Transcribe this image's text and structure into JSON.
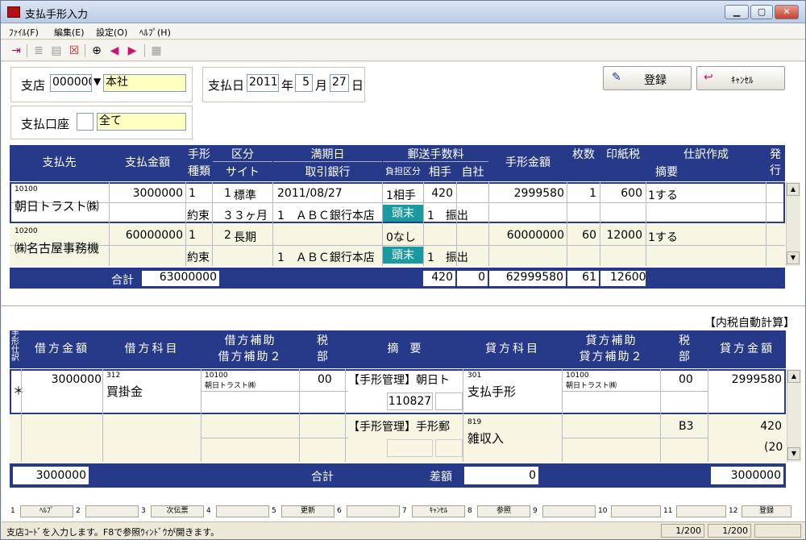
{
  "window": {
    "title": "支払手形入力",
    "min": "▁",
    "max": "▢",
    "close": "✕"
  },
  "menu": [
    "ﾌｧｲﾙ(F)",
    "編集(E)",
    "設定(O)",
    "ﾍﾙﾌﾟ(H)"
  ],
  "header": {
    "store_label": "支店",
    "store_code": "000000",
    "store_dropdown": "▼",
    "store_name": "本社",
    "date_label": "支払日",
    "year": "2011",
    "year_unit": "年",
    "month": "5",
    "month_unit": "月",
    "day": "27",
    "day_unit": "日",
    "account_label": "支払口座",
    "account_name": "全て",
    "register": "登録",
    "cancel": "ｷｬﾝｾﾙ"
  },
  "top_headers": {
    "payee": "支払先",
    "pay_amount": "支払金額",
    "note_type1": "手形",
    "note_type2": "種類",
    "category": "区分",
    "site": "サイト",
    "maturity": "満期日",
    "bank": "取引銀行",
    "mail_fee": "郵送手数料",
    "burden": "負担区分",
    "partner": "相手",
    "own": "自社",
    "note_amount": "手形金額",
    "count": "枚数",
    "stamp": "印紙税",
    "journal": "仕訳作成",
    "summary": "摘要",
    "issue1": "発",
    "issue2": "行"
  },
  "top_rows": [
    {
      "code": "10100",
      "name": "朝日トラスト㈱",
      "amount": "3000000",
      "type_no": "1",
      "type_name": "約束",
      "cat": "1",
      "cat_name": "標準",
      "site": "３３ヶ月",
      "maturity": "2011/08/27",
      "bank": "1　ＡＢＣ銀行本店",
      "burden": "1相手",
      "burden_tag": "頭末",
      "partner_fee": "420",
      "own_fee": "",
      "method": "1　振出",
      "note_amount": "2999580",
      "count": "1",
      "stamp": "600",
      "journal": "1する"
    },
    {
      "code": "10200",
      "name": "㈱名古屋事務機",
      "amount": "60000000",
      "type_no": "1",
      "type_name": "約束",
      "cat": "2",
      "cat_name": "長期",
      "site": "",
      "maturity": "",
      "bank": "1　ＡＢＣ銀行本店",
      "burden": "0なし",
      "burden_tag": "頭末",
      "partner_fee": "",
      "own_fee": "",
      "method": "1　振出",
      "note_amount": "60000000",
      "count": "60",
      "stamp": "12000",
      "journal": "1する"
    }
  ],
  "top_total": {
    "label": "合計",
    "amount": "63000000",
    "partner_fee": "420",
    "own_fee": "0",
    "note_amount": "62999580",
    "count": "61",
    "stamp": "12600"
  },
  "tax_note": "【内税自動計算】",
  "bottom_headers": {
    "note_cls": "手形仕訳",
    "debit_amount": "借方金額",
    "debit_account": "借方科目",
    "debit_sub1": "借方補助",
    "debit_sub2": "借方補助２",
    "tax1": "税",
    "tax2": "部",
    "summary": "摘　要",
    "credit_account": "貸方科目",
    "credit_sub1": "貸方補助",
    "credit_sub2": "貸方補助２",
    "ctax1": "税",
    "ctax2": "部",
    "credit_amount": "貸方金額"
  },
  "bottom_rows": [
    {
      "mark": "＊",
      "debit_amount": "3000000",
      "debit_code": "312",
      "debit_name": "買掛金",
      "sub_code": "10100",
      "sub_name": "朝日トラスト㈱",
      "tax": "00",
      "summary": "【手形管理】朝日ト",
      "summary_no": "110827",
      "credit_code": "301",
      "credit_name": "支払手形",
      "csub_code": "10100",
      "csub_name": "朝日トラスト㈱",
      "ctax": "00",
      "credit_amount": "2999580"
    },
    {
      "mark": "",
      "debit_amount": "",
      "debit_code": "",
      "debit_name": "",
      "sub_code": "",
      "sub_name": "",
      "tax": "",
      "summary": "【手形管理】手形郵",
      "summary_no": "",
      "credit_code": "819",
      "credit_name": "雑収入",
      "csub_code": "",
      "csub_name": "",
      "ctax": "B3",
      "credit_amount": "420",
      "credit_amount2": "(20"
    }
  ],
  "bottom_total": {
    "debit": "3000000",
    "label": "合計",
    "diff_label": "差額",
    "diff": "0",
    "credit": "3000000"
  },
  "fkeys": [
    {
      "n": "1",
      "l": "ﾍﾙﾌﾟ"
    },
    {
      "n": "2",
      "l": ""
    },
    {
      "n": "3",
      "l": "次伝票"
    },
    {
      "n": "4",
      "l": ""
    },
    {
      "n": "5",
      "l": "更新"
    },
    {
      "n": "6",
      "l": ""
    },
    {
      "n": "7",
      "l": "ｷｬﾝｾﾙ"
    },
    {
      "n": "8",
      "l": "参照"
    },
    {
      "n": "9",
      "l": ""
    },
    {
      "n": "10",
      "l": ""
    },
    {
      "n": "11",
      "l": ""
    },
    {
      "n": "12",
      "l": "登録"
    }
  ],
  "status": {
    "message": "支店ｺｰﾄﾞを入力します。F8で参照ｳｨﾝﾄﾞｳが開きます。",
    "page1": "1/200",
    "page2": "1/200"
  },
  "scroll": {
    "up": "▲",
    "down": "▼"
  }
}
